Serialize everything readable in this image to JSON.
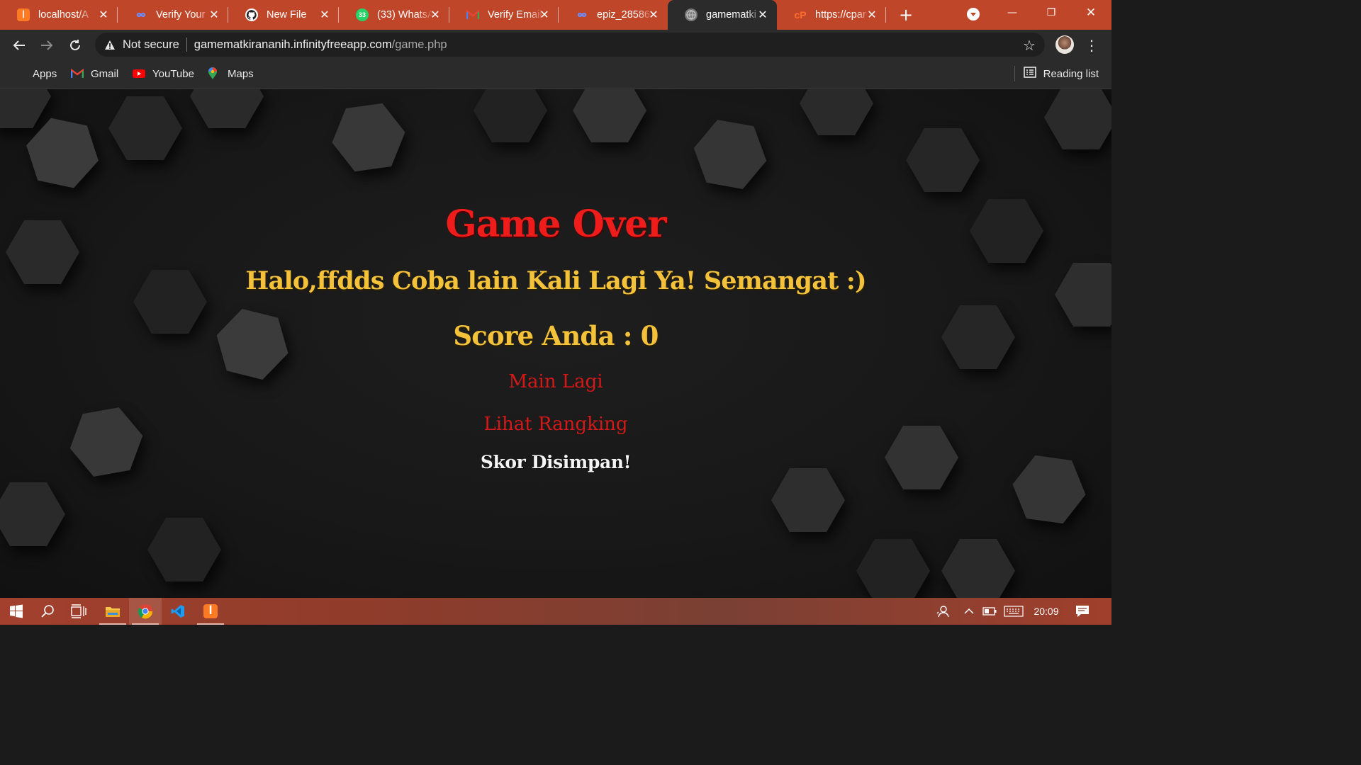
{
  "browser": {
    "tabs": [
      {
        "label": "localhost/A",
        "icon": "xampp-icon",
        "active": false
      },
      {
        "label": "Verify Your",
        "icon": "infinityfree-icon",
        "active": false
      },
      {
        "label": "New File",
        "icon": "github-icon",
        "active": false
      },
      {
        "label": "(33) WhatsA",
        "icon": "whatsapp-icon",
        "active": false,
        "badge": "33"
      },
      {
        "label": "Verify Email",
        "icon": "gmail-icon",
        "active": false
      },
      {
        "label": "epiz_28586",
        "icon": "infinityfree-icon",
        "active": false
      },
      {
        "label": "gamematki",
        "icon": "globe-icon",
        "active": true
      },
      {
        "label": "https://cpar",
        "icon": "cpanel-icon",
        "active": false
      }
    ],
    "address": {
      "security_label": "Not secure",
      "host": "gamematkirananih.infinityfreeapp.com",
      "path": "/game.php"
    },
    "bookmarks": [
      {
        "label": "Apps",
        "icon": "apps-grid-icon"
      },
      {
        "label": "Gmail",
        "icon": "gmail-icon"
      },
      {
        "label": "YouTube",
        "icon": "youtube-icon"
      },
      {
        "label": "Maps",
        "icon": "maps-icon"
      }
    ],
    "reading_list_label": "Reading list"
  },
  "game": {
    "title": "Game Over",
    "message": "Halo,ffdds Coba lain Kali Lagi Ya! Semangat :)",
    "score_line": "Score Anda : 0",
    "play_again": "Main Lagi",
    "ranking": "Lihat Rangking",
    "saved_notice": "Skor Disimpan!"
  },
  "taskbar": {
    "clock": "20:09",
    "apps": [
      "start-icon",
      "search-icon",
      "task-view-icon",
      "file-explorer-icon",
      "chrome-icon",
      "vscode-icon",
      "xampp-icon"
    ]
  },
  "colors": {
    "tabstrip": "#c0462a",
    "title_red": "#ef1c1c",
    "gold": "#f3c13a",
    "link_red": "#d51818"
  }
}
